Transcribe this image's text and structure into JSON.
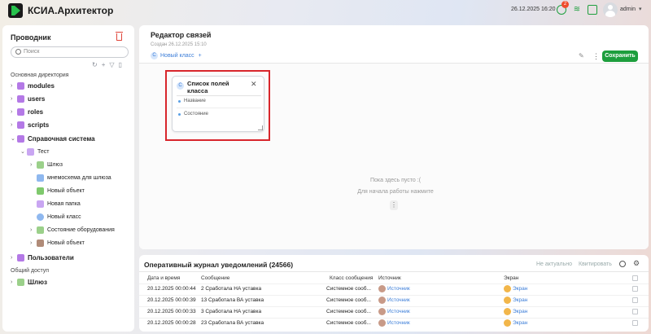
{
  "app": {
    "title": "КСИА.Архитектор"
  },
  "topbar": {
    "datetime": "26.12.2025 16:20",
    "alarm_count": "2",
    "user": "admin"
  },
  "sidebar": {
    "title": "Проводник",
    "search_placeholder": "Поиск",
    "section_main": "Основная директория",
    "section_shared": "Общий доступ",
    "items": [
      {
        "label": "modules"
      },
      {
        "label": "users"
      },
      {
        "label": "roles"
      },
      {
        "label": "scripts"
      },
      {
        "label": "Справочная система"
      },
      {
        "label": "Тест"
      },
      {
        "label": "Шлюз"
      },
      {
        "label": "мнемосхема для шлюза"
      },
      {
        "label": "Новый объект"
      },
      {
        "label": "Новая папка"
      },
      {
        "label": "Новый класс"
      },
      {
        "label": "Состояние оборудования"
      },
      {
        "label": "Новый объект"
      },
      {
        "label": "Пользователи"
      },
      {
        "label": "Шлюз"
      }
    ]
  },
  "editor": {
    "title": "Редактор связей",
    "subtitle": "Создан 26.12.2025 15:10",
    "class_badge": "С",
    "class_label": "Новый класс",
    "save_label": "Сохранить",
    "empty_line1": "Пока здесь пусто :(",
    "empty_line2": "Для начала работы нажмите",
    "card": {
      "badge": "С",
      "title": "Список полей класса",
      "fields": [
        "Название",
        "Состояние"
      ]
    }
  },
  "journal": {
    "title": "Оперативный журнал уведомлений (24566)",
    "btn_irrelevant": "Не актуально",
    "btn_ack": "Квитировать",
    "columns": [
      "Дата и время",
      "Сообщение",
      "Класс сообщения",
      "Источник",
      "Экран"
    ],
    "rows": [
      {
        "time": "20.12.2025 00:00:44",
        "message": "2 Сработала НА уставка",
        "class": "Системное сооб...",
        "source": "Источник",
        "screen": "Экран"
      },
      {
        "time": "20.12.2025 00:00:39",
        "message": "13 Сработала ВА уставка",
        "class": "Системное сооб...",
        "source": "Источник",
        "screen": "Экран"
      },
      {
        "time": "20.12.2025 00:00:33",
        "message": "3 Сработала НА уставка",
        "class": "Системное сооб...",
        "source": "Источник",
        "screen": "Экран"
      },
      {
        "time": "20.12.2025 00:00:28",
        "message": "23 Сработала ВА уставка",
        "class": "Системное сооб...",
        "source": "Источник",
        "screen": "Экран"
      }
    ]
  },
  "colors": {
    "accent_green": "#1d9e3d",
    "highlight_red": "#d8262c",
    "link_blue": "#3b7dd8"
  }
}
